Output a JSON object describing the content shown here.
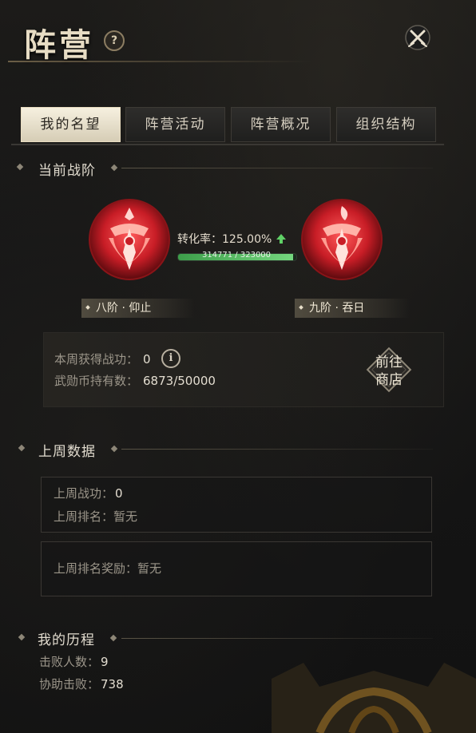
{
  "header": {
    "title": "阵营",
    "help_label": "?"
  },
  "tabs": [
    "我的名望",
    "阵营活动",
    "阵营概况",
    "组织结构"
  ],
  "current_rank": {
    "section_title": "当前战阶",
    "conversion_label": "转化率：",
    "conversion_value": "125.00%",
    "progress_text": "314771 / 323000",
    "progress_fraction": 0.9745,
    "current_rank_label": "八阶 · 仰止",
    "next_rank_label": "九阶 · 吞日"
  },
  "weekly": {
    "merit_label": "本周获得战功：",
    "merit_value": "0",
    "coins_label": "武勋币持有数：",
    "coins_value": "6873/50000",
    "info_icon": "i",
    "shop_button_line1": "前往",
    "shop_button_line2": "商店"
  },
  "last_week": {
    "section_title": "上周数据",
    "merit_label": "上周战功：",
    "merit_value": "0",
    "rank_label": "上周排名：",
    "rank_value": "暂无",
    "reward_label": "上周排名奖励：",
    "reward_value": "暂无"
  },
  "history": {
    "section_title": "我的历程",
    "defeats_label": "击败人数：",
    "defeats_value": "9",
    "assists_label": "协助击败：",
    "assists_value": "738"
  },
  "colors": {
    "accent_red": "#d9202a",
    "progress_green": "#5cc46a",
    "tab_active": "#efe7d2"
  }
}
